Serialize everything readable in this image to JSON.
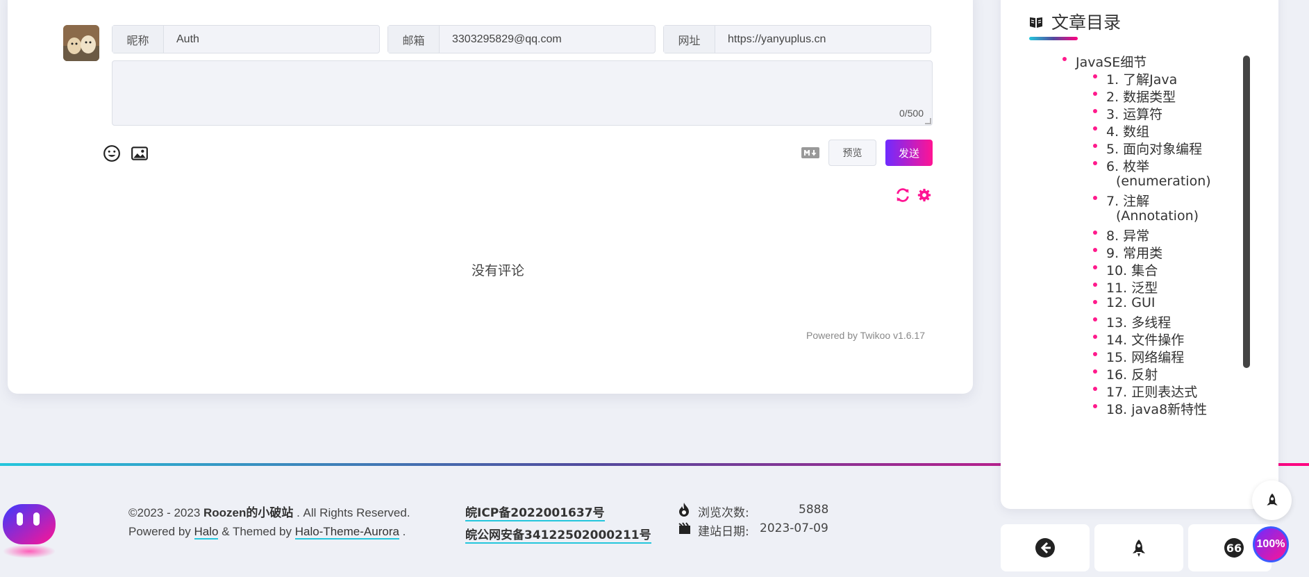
{
  "comment_form": {
    "nickname_label": "昵称",
    "nickname_value": "Auth",
    "email_label": "邮箱",
    "email_value": "3303295829@qq.com",
    "website_label": "网址",
    "website_value": "https://yanyuplus.cn",
    "char_counter": "0/500",
    "preview_label": "预览",
    "send_label": "发送",
    "no_comments": "没有评论",
    "powered_by": "Powered by Twikoo v1.6.17"
  },
  "footer": {
    "copyright_prefix": "©2023 - 2023 ",
    "site_name": "Roozen的小破站",
    "copyright_suffix": " . All Rights Reserved.",
    "powered_prefix": "Powered by ",
    "halo_link": "Halo",
    "themed_text": " & Themed by ",
    "theme_link": "Halo-Theme-Aurora",
    "period": " .",
    "icp": "皖ICP备2022001637号",
    "police": "皖公网安备34122502000211号",
    "views_label": "浏览次数:",
    "views_value": "5888",
    "built_label": "建站日期:",
    "built_value": "2023-07-09"
  },
  "toc": {
    "title": "文章目录",
    "root": "JavaSE细节",
    "items": [
      "1. 了解Java",
      "2. 数据类型",
      "3. 运算符",
      "4. 数组",
      "5. 面向对象编程",
      "6. 枚举",
      "(enumeration)",
      "7. 注解",
      "(Annotation)",
      "8. 异常",
      "9. 常用类",
      "10. 集合",
      "11. 泛型",
      "12. GUI",
      "13. 多线程",
      "14. 文件操作",
      "15. 网络编程",
      "16. 反射",
      "17. 正则表达式",
      "18. java8新特性"
    ]
  },
  "widgets": {
    "progress_label": "100%"
  },
  "colors": {
    "accent_pink": "#ff1493",
    "accent_purple": "#6f2bff",
    "accent_cyan": "#24c6dc"
  }
}
